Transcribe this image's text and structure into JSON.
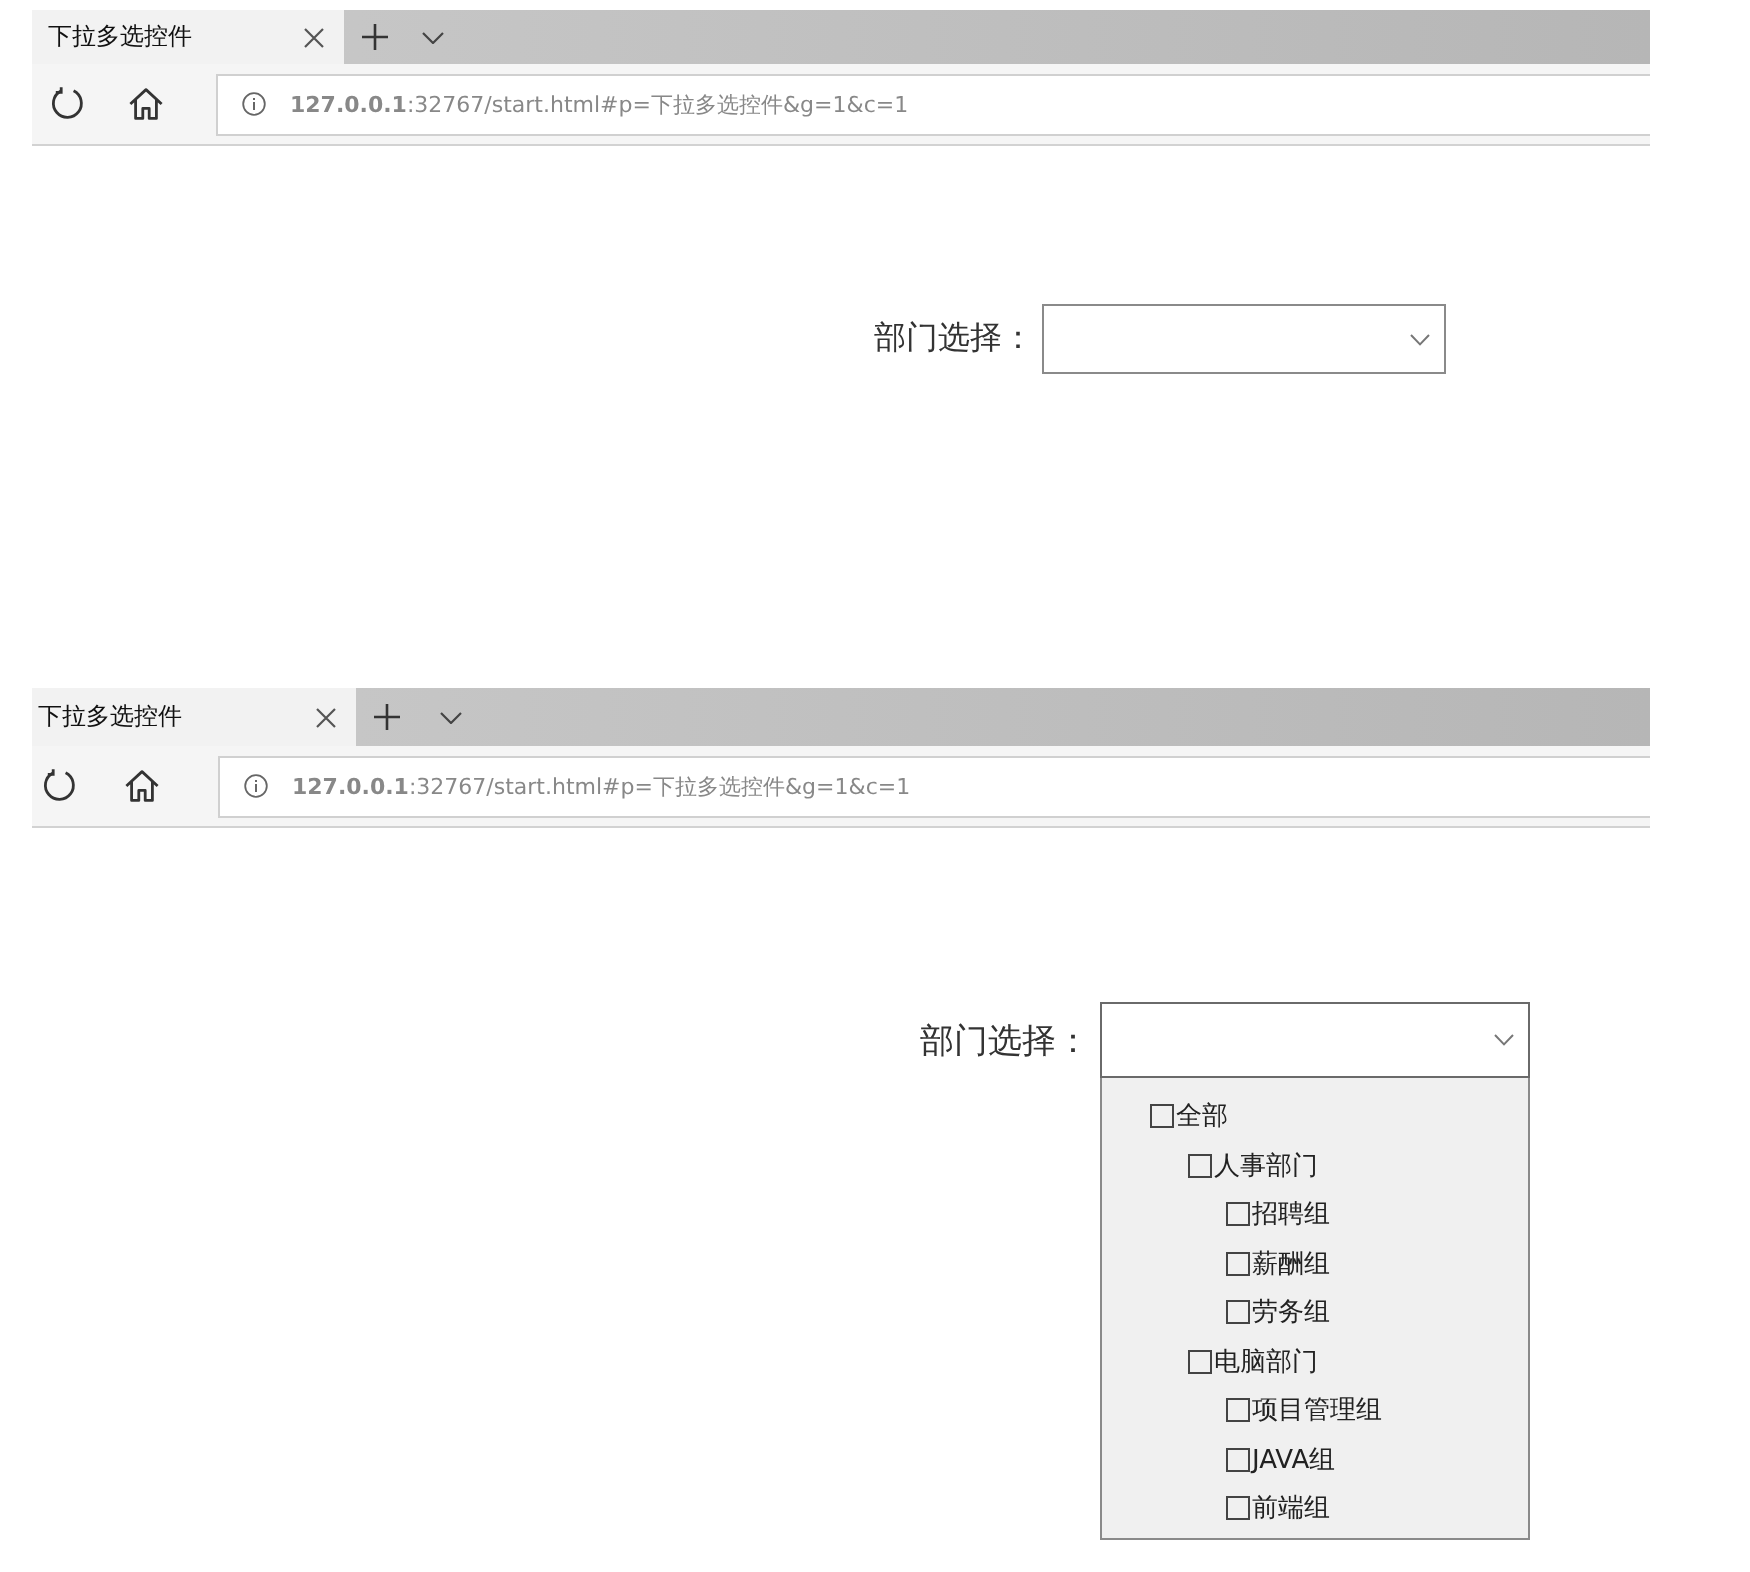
{
  "screens": [
    {
      "tabs": [
        {
          "title": "下拉多选控件",
          "selected": true
        }
      ],
      "address": {
        "url": "**127.0.0.1**:32767/start.html#p=下拉多选控件&g=1&c=1"
      },
      "form": {
        "label": "部门选择：",
        "expanded": false
      }
    },
    {
      "tabs": [
        {
          "title": "下拉多选控件",
          "selected": true
        }
      ],
      "address": {
        "url": "**127.0.0.1**:32767/start.html#p=下拉多选控件&g=1&c=1"
      },
      "form": {
        "label": "部门选择：",
        "expanded": true,
        "options": [
          {
            "label": "全部",
            "checked": false,
            "children": [
              {
                "label": "人事部门",
                "checked": false,
                "children": [
                  {
                    "label": "招聘组",
                    "checked": false
                  },
                  {
                    "label": "薪酬组",
                    "checked": false
                  },
                  {
                    "label": "劳务组",
                    "checked": false
                  }
                ]
              },
              {
                "label": "电脑部门",
                "checked": false,
                "children": [
                  {
                    "label": "项目管理组",
                    "checked": false
                  },
                  {
                    "label": "JAVA组",
                    "checked": false
                  },
                  {
                    "label": "前端组",
                    "checked": false
                  }
                ]
              }
            ]
          }
        ]
      }
    }
  ]
}
